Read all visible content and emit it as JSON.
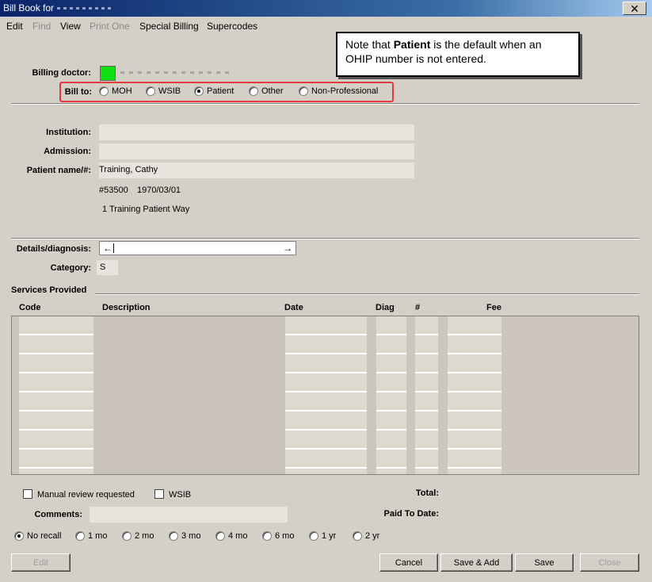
{
  "window": {
    "title": "Bill Book for",
    "close_label": "✕"
  },
  "menu": {
    "items": [
      {
        "label": "Edit",
        "enabled": true
      },
      {
        "label": "Find",
        "enabled": false
      },
      {
        "label": "View",
        "enabled": true
      },
      {
        "label": "Print One",
        "enabled": false
      },
      {
        "label": "Special Billing",
        "enabled": true
      },
      {
        "label": "Supercodes",
        "enabled": true
      }
    ]
  },
  "callout": {
    "prefix": "Note that ",
    "bold": "Patient",
    "suffix": " is the default when an OHIP number is not entered."
  },
  "billing": {
    "doctor_label": "Billing doctor:",
    "doctor_color": "#10e010",
    "bill_to_label": "Bill to:",
    "bill_to_options": [
      "MOH",
      "WSIB",
      "Patient",
      "Other",
      "Non-Professional"
    ],
    "bill_to_selected": "Patient"
  },
  "patient": {
    "institution_label": "Institution:",
    "admission_label": "Admission:",
    "name_label": "Patient name/#:",
    "name": "Training, Cathy",
    "number": "#53500",
    "dob": "1970/03/01",
    "address": "1 Training Patient Way"
  },
  "details": {
    "details_label": "Details/diagnosis:",
    "arrow_left": "←",
    "arrow_right": "→",
    "category_label": "Category:",
    "category_value": "S"
  },
  "services": {
    "section_label": "Services Provided",
    "columns": [
      "Code",
      "Description",
      "Date",
      "Diag",
      "#",
      "Fee"
    ]
  },
  "options": {
    "manual_review_label": "Manual review requested",
    "wsib_label": "WSIB",
    "total_label": "Total:",
    "comments_label": "Comments:",
    "paid_to_date_label": "Paid To Date:",
    "recall_options": [
      "No recall",
      "1 mo",
      "2 mo",
      "3 mo",
      "4 mo",
      "6 mo",
      "1 yr",
      "2 yr"
    ],
    "recall_selected": "No recall"
  },
  "buttons": {
    "edit": "Edit",
    "cancel": "Cancel",
    "save_add": "Save & Add",
    "save": "Save",
    "close": "Close"
  }
}
